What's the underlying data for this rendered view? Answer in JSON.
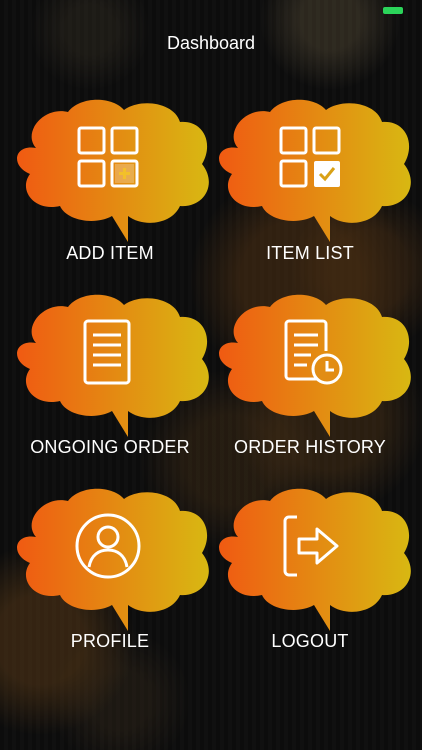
{
  "status_bar": {
    "battery_color": "#2bd45a"
  },
  "header": {
    "title": "Dashboard"
  },
  "tiles": [
    {
      "label": "ADD ITEM",
      "icon": "add-grid-icon"
    },
    {
      "label": "ITEM LIST",
      "icon": "check-grid-icon"
    },
    {
      "label": "ONGOING ORDER",
      "icon": "document-icon"
    },
    {
      "label": "ORDER HISTORY",
      "icon": "document-clock-icon"
    },
    {
      "label": "PROFILE",
      "icon": "user-icon"
    },
    {
      "label": "LOGOUT",
      "icon": "logout-icon"
    }
  ],
  "colors": {
    "gradient_start": "#f05a12",
    "gradient_end": "#d8b812",
    "text": "#ffffff"
  }
}
